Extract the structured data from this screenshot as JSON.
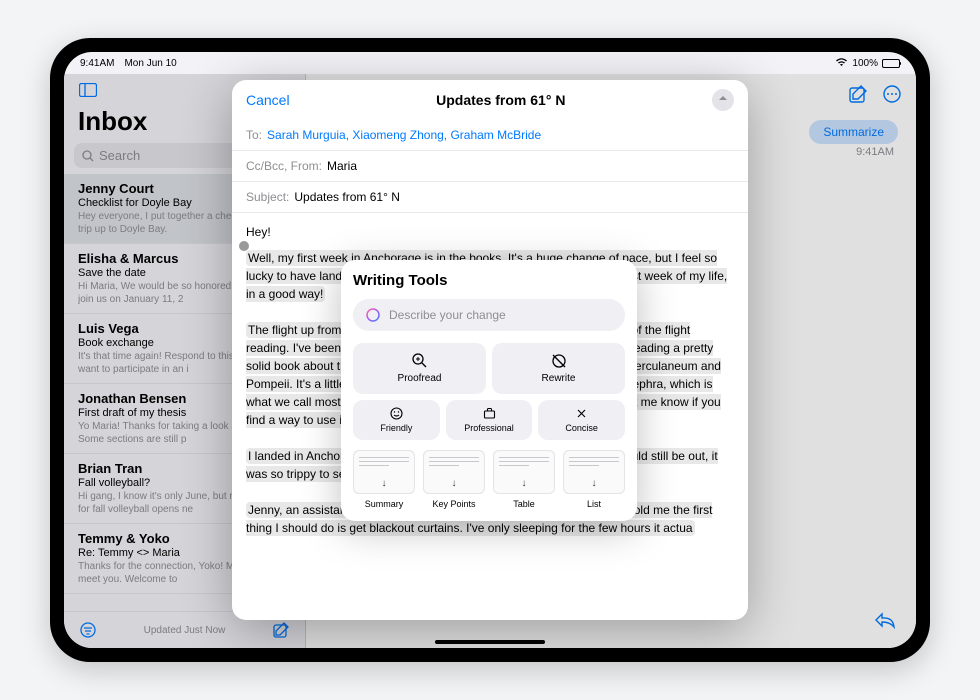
{
  "status": {
    "time": "9:41AM",
    "date": "Mon Jun 10",
    "battery": "100%"
  },
  "sidebar": {
    "title": "Inbox",
    "search_placeholder": "Search",
    "footer_status": "Updated Just Now",
    "emails": [
      {
        "sender": "Jenny Court",
        "subject": "Checklist for Doyle Bay",
        "preview": "Hey everyone, I put together a checklist for our trip up to Doyle Bay."
      },
      {
        "sender": "Elisha & Marcus",
        "subject": "Save the date",
        "preview": "Hi Maria, We would be so honored if you would join us on January 11, 2"
      },
      {
        "sender": "Luis Vega",
        "subject": "Book exchange",
        "preview": "It's that time again! Respond to this email if you want to participate in an i"
      },
      {
        "sender": "Jonathan Bensen",
        "subject": "First draft of my thesis",
        "preview": "Yo Maria! Thanks for taking a look at my draft. Some sections are still p"
      },
      {
        "sender": "Brian Tran",
        "subject": "Fall volleyball?",
        "preview": "Hi gang, I know it's only June, but registration for fall volleyball opens ne"
      },
      {
        "sender": "Temmy & Yoko",
        "subject": "Re: Temmy <> Maria",
        "preview": "Thanks for the connection, Yoko! Maria, nice to meet you. Welcome to"
      }
    ]
  },
  "main": {
    "summarize_label": "Summarize",
    "timestamp": "9:41AM"
  },
  "compose": {
    "cancel": "Cancel",
    "title": "Updates from 61° N",
    "to_label": "To:",
    "recipients": "Sarah Murguia, Xiaomeng Zhong, Graham McBride",
    "ccbcc_label": "Cc/Bcc, From:",
    "from_value": "Maria",
    "subject_label": "Subject:",
    "subject_value": "Updates from 61° N",
    "body_greeting": "Hey!",
    "body_p1": "Well, my first week in Anchorage is in the books. It's a huge change of pace, but I feel so lucky to have landed here. I'm not gonna lie though — this was the longest week of my life, in a good way!",
    "body_p2": "The flight up from Seattle was shorter than I expected, and I spent most of the flight reading. I've been on a history of volcanoes kick lately, and I'm currently reading a pretty solid book about the eruption of Vesuvius and its impact on the cities of Herculaneum and Pompeii. It's a little dry at points though. Fun fact: I learned a new word: tephra, which is what we call most of the stuff that flies out of a volcano when it erupts. Let me know if you find a way to use it in a sentence.",
    "body_p3": "I landed in Anchorage around 9 PM, and even though I knew the sun would still be out, it was so trippy to see it firsthand.",
    "body_p4": "Jenny, an assistant at the university, picked me up from the airport. She told me the first thing I should do is get blackout curtains. I've only sleeping for the few hours it actua"
  },
  "writing_tools": {
    "title": "Writing Tools",
    "input_placeholder": "Describe your change",
    "proofread": "Proofread",
    "rewrite": "Rewrite",
    "friendly": "Friendly",
    "professional": "Professional",
    "concise": "Concise",
    "summary": "Summary",
    "key_points": "Key Points",
    "table": "Table",
    "list": "List"
  }
}
